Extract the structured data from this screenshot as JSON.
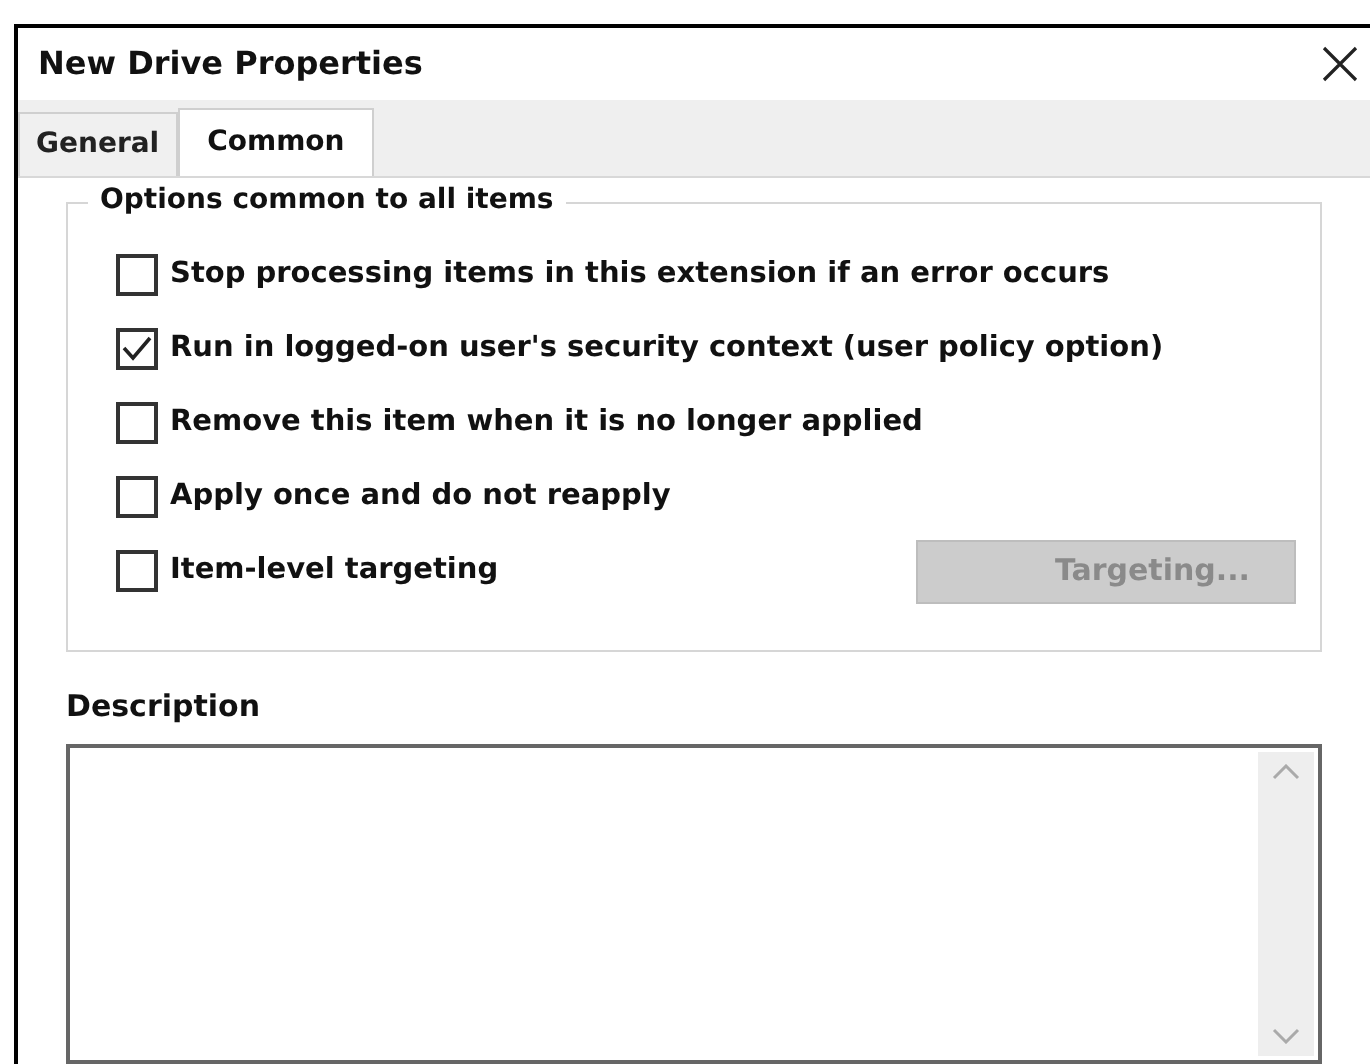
{
  "window": {
    "title": "New Drive Properties"
  },
  "tabs": [
    {
      "label": "General",
      "selected": false
    },
    {
      "label": "Common",
      "selected": true
    }
  ],
  "options_group": {
    "title": "Options common to all items",
    "options": [
      {
        "label": "Stop processing items in this extension if an error occurs",
        "checked": false
      },
      {
        "label": "Run in logged-on user's security context (user policy option)",
        "checked": true
      },
      {
        "label": "Remove this item when it is no longer applied",
        "checked": false
      },
      {
        "label": "Apply once and do not reapply",
        "checked": false
      },
      {
        "label": "Item-level targeting",
        "checked": false
      }
    ],
    "targeting_button": {
      "label": "Targeting...",
      "disabled": true
    }
  },
  "description": {
    "label": "Description"
  }
}
